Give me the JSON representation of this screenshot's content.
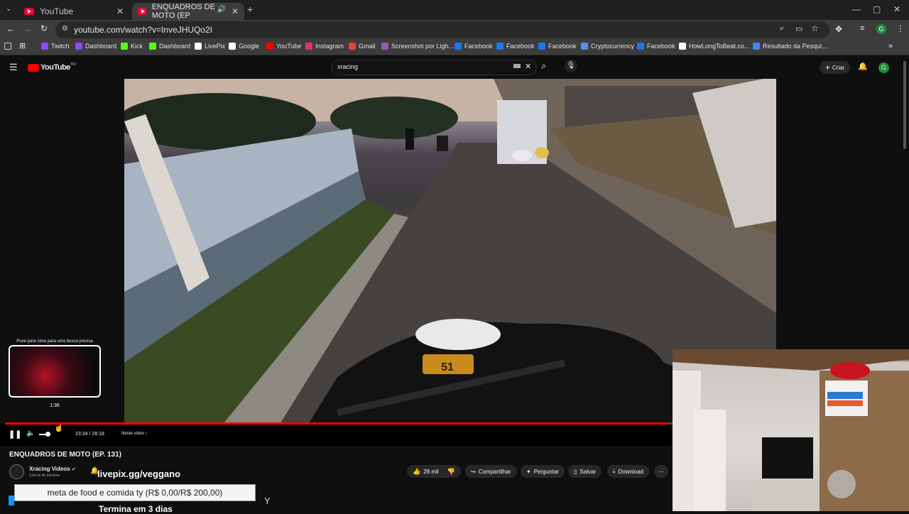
{
  "browser": {
    "tabs": [
      {
        "title": "YouTube"
      },
      {
        "title": "ENQUADROS DE MOTO (EP"
      }
    ],
    "new_tab": "+",
    "url": "youtube.com/watch?v=InveJHUQo2I",
    "bookmarks": [
      {
        "label": "Twitch",
        "color": "#9146ff"
      },
      {
        "label": "Dashboard",
        "color": "#9146ff"
      },
      {
        "label": "Kick",
        "color": "#53fc18"
      },
      {
        "label": "Dashboard",
        "color": "#53fc18"
      },
      {
        "label": "LivePix",
        "color": "#ffffff"
      },
      {
        "label": "Google",
        "color": "#ffffff"
      },
      {
        "label": "YouTube",
        "color": "#ff0000"
      },
      {
        "label": "Instagram",
        "color": "#e1306c"
      },
      {
        "label": "Gmail",
        "color": "#ea4335"
      },
      {
        "label": "Screenshot por Ligh...",
        "color": "#9b59b6"
      },
      {
        "label": "Facebook",
        "color": "#1877f2"
      },
      {
        "label": "Facebook",
        "color": "#1877f2"
      },
      {
        "label": "Facebook",
        "color": "#1877f2"
      },
      {
        "label": "Cryptocurrency",
        "color": "#5b8def"
      },
      {
        "label": "Facebook",
        "color": "#1877f2"
      },
      {
        "label": "HowLongToBeat.co...",
        "color": "#ffffff"
      },
      {
        "label": "Resultado da Pesqui...",
        "color": "#4285f4"
      }
    ]
  },
  "youtube": {
    "logo": "YouTube",
    "logo_region": "BR",
    "search_value": "xracing",
    "create_label": "Criar",
    "avatar_letter": "G"
  },
  "player": {
    "speedometer": "51",
    "preview_hint": "Puxe para cima para uma busca precisa",
    "preview_time": "1:36",
    "time_display": "23:34 / 28:18",
    "chapter": "Neste vídeo",
    "progress_fraction": 0.993
  },
  "video": {
    "title": "ENQUADROS DE MOTO (EP. 131)",
    "channel": "Xracing Videos",
    "subscribers": "3,64 mi de inscritos",
    "likes": "28 mil",
    "share": "Compartilhar",
    "ask": "Perguntar",
    "save": "Salvar",
    "download": "Download"
  },
  "overlay": {
    "livepix": "livepix.gg/veggano",
    "goal": "meta de food e comida ty (R$ 0,00/R$ 200,00)",
    "ends": "Termina em 3 dias"
  },
  "colors": {
    "accent": "#ff0000",
    "background": "#0f0f0f"
  }
}
